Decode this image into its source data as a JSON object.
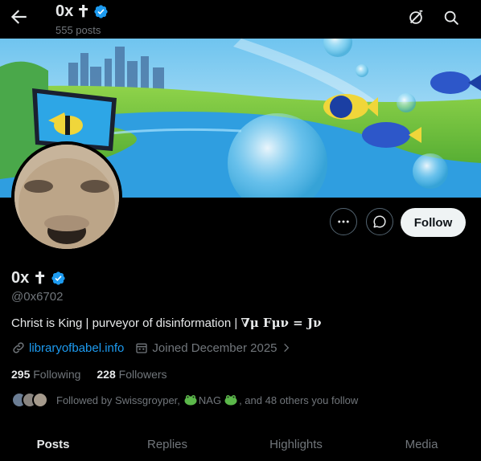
{
  "topbar": {
    "title": "0x",
    "title_symbol": "✝",
    "posts_count": "555 posts",
    "back_icon": "arrow-left-icon",
    "grok_icon": "grok-icon",
    "search_icon": "search-icon"
  },
  "profile": {
    "display_name": "0x",
    "name_symbol": "✝",
    "handle": "@0x6702",
    "bio_text": "Christ is King | purveyor of disinformation |",
    "bio_math": "∇μ  Fμν  =  Jν",
    "website": "libraryofbabel.info",
    "joined": "Joined December 2025",
    "verified_color": "#1d9bf0"
  },
  "actions": {
    "more_icon": "more-icon",
    "message_icon": "message-icon",
    "follow_label": "Follow"
  },
  "stats": {
    "following_count": "295",
    "following_label": "Following",
    "followers_count": "228",
    "followers_label": "Followers"
  },
  "followed_by": {
    "prefix": "Followed by Swissgroyper,",
    "nag": "NAG",
    "suffix": ", and 48 others you follow"
  },
  "tabs": [
    "Posts",
    "Replies",
    "Highlights",
    "Media"
  ],
  "colors": {
    "accent": "#1d9bf0",
    "background": "#000000",
    "text": "#e7e9ea",
    "muted": "#71767b"
  }
}
